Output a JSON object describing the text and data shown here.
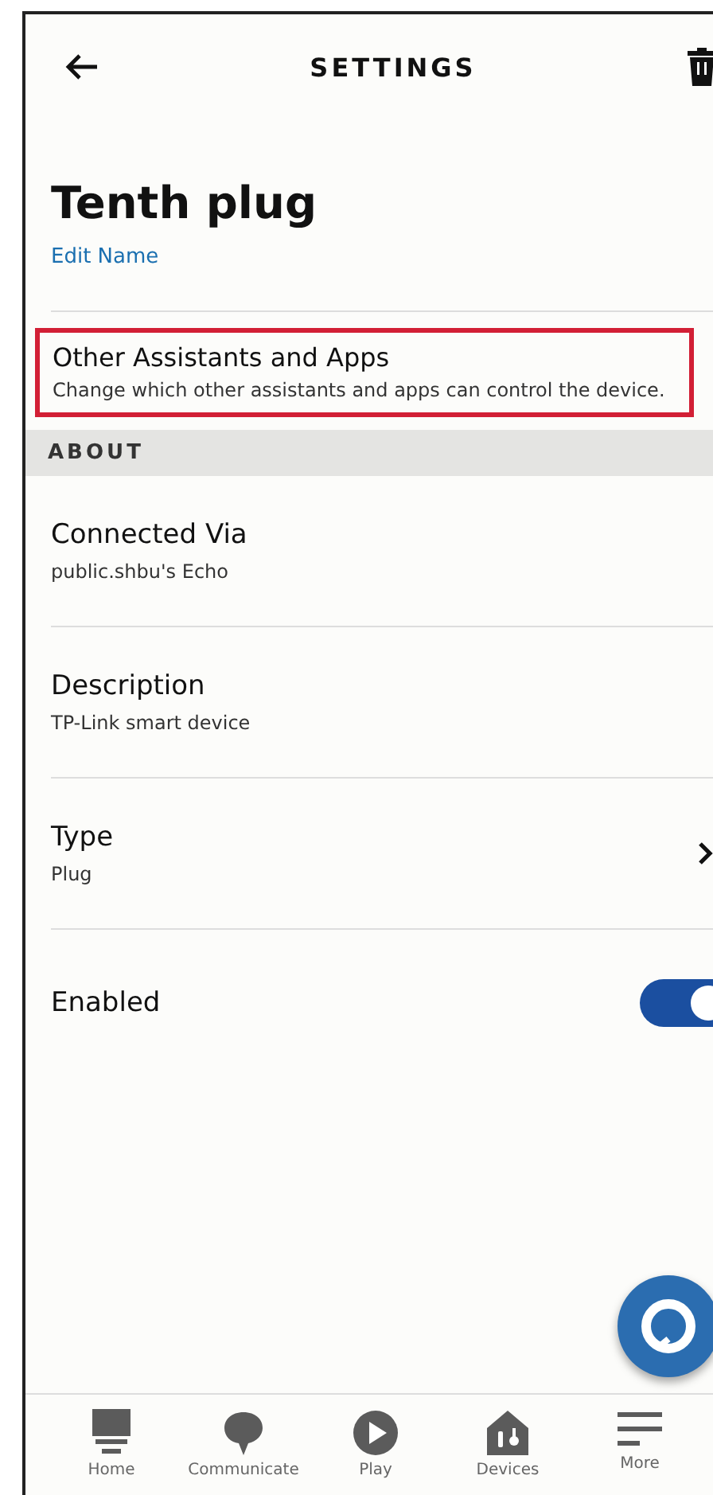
{
  "header": {
    "title": "SETTINGS"
  },
  "device": {
    "name": "Tenth plug",
    "edit_link": "Edit Name"
  },
  "assistants": {
    "title": "Other Assistants and Apps",
    "description": "Change which other assistants and apps can control the device.",
    "highlighted": true
  },
  "section": {
    "label": "ABOUT"
  },
  "rows": [
    {
      "kind": "info",
      "title": "Connected Via",
      "value": "public.shbu's Echo"
    },
    {
      "kind": "info",
      "title": "Description",
      "value": "TP-Link smart device"
    },
    {
      "kind": "link",
      "title": "Type",
      "value": "Plug"
    },
    {
      "kind": "toggle",
      "title": "Enabled",
      "on": true
    }
  ],
  "nav": [
    {
      "kind": "home",
      "label": "Home"
    },
    {
      "kind": "communicate",
      "label": "Communicate"
    },
    {
      "kind": "play",
      "label": "Play"
    },
    {
      "kind": "devices",
      "label": "Devices"
    },
    {
      "kind": "more",
      "label": "More"
    }
  ]
}
